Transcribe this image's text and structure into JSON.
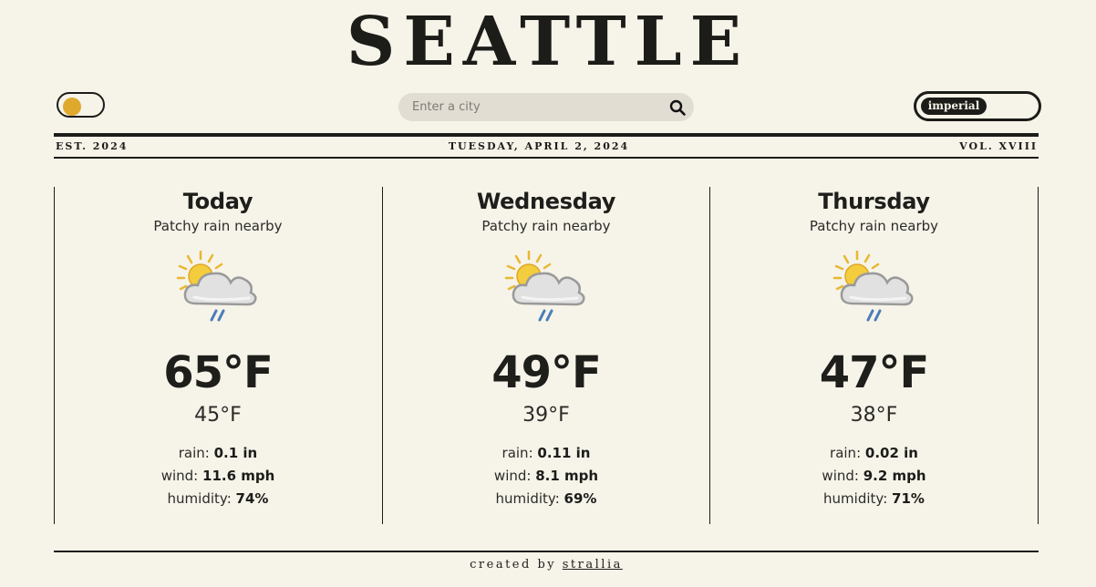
{
  "header": {
    "city_title": "SEATTLE",
    "search": {
      "placeholder": "Enter a city",
      "value": ""
    },
    "unit_label": "imperial",
    "masthead": {
      "est": "EST. 2024",
      "date": "TUESDAY, APRIL 2, 2024",
      "volume": "VOL. XVIII"
    }
  },
  "forecast": [
    {
      "day": "Today",
      "condition": "Patchy rain nearby",
      "icon": "patchy-rain-icon",
      "high": "65°F",
      "low": "45°F",
      "rain_label": "rain:",
      "rain": "0.1 in",
      "wind_label": "wind:",
      "wind": "11.6 mph",
      "humidity_label": "humidity:",
      "humidity": "74%"
    },
    {
      "day": "Wednesday",
      "condition": "Patchy rain nearby",
      "icon": "patchy-rain-icon",
      "high": "49°F",
      "low": "39°F",
      "rain_label": "rain:",
      "rain": "0.11 in",
      "wind_label": "wind:",
      "wind": "8.1 mph",
      "humidity_label": "humidity:",
      "humidity": "69%"
    },
    {
      "day": "Thursday",
      "condition": "Patchy rain nearby",
      "icon": "patchy-rain-icon",
      "high": "47°F",
      "low": "38°F",
      "rain_label": "rain:",
      "rain": "0.02 in",
      "wind_label": "wind:",
      "wind": "9.2 mph",
      "humidity_label": "humidity:",
      "humidity": "71%"
    }
  ],
  "footer": {
    "created_by": "created by",
    "author": "strallia"
  },
  "colors": {
    "background": "#f6f3e9",
    "ink": "#1c1c19",
    "accent_sun": "#dfa92e",
    "search_bg": "#e1ddd3"
  }
}
